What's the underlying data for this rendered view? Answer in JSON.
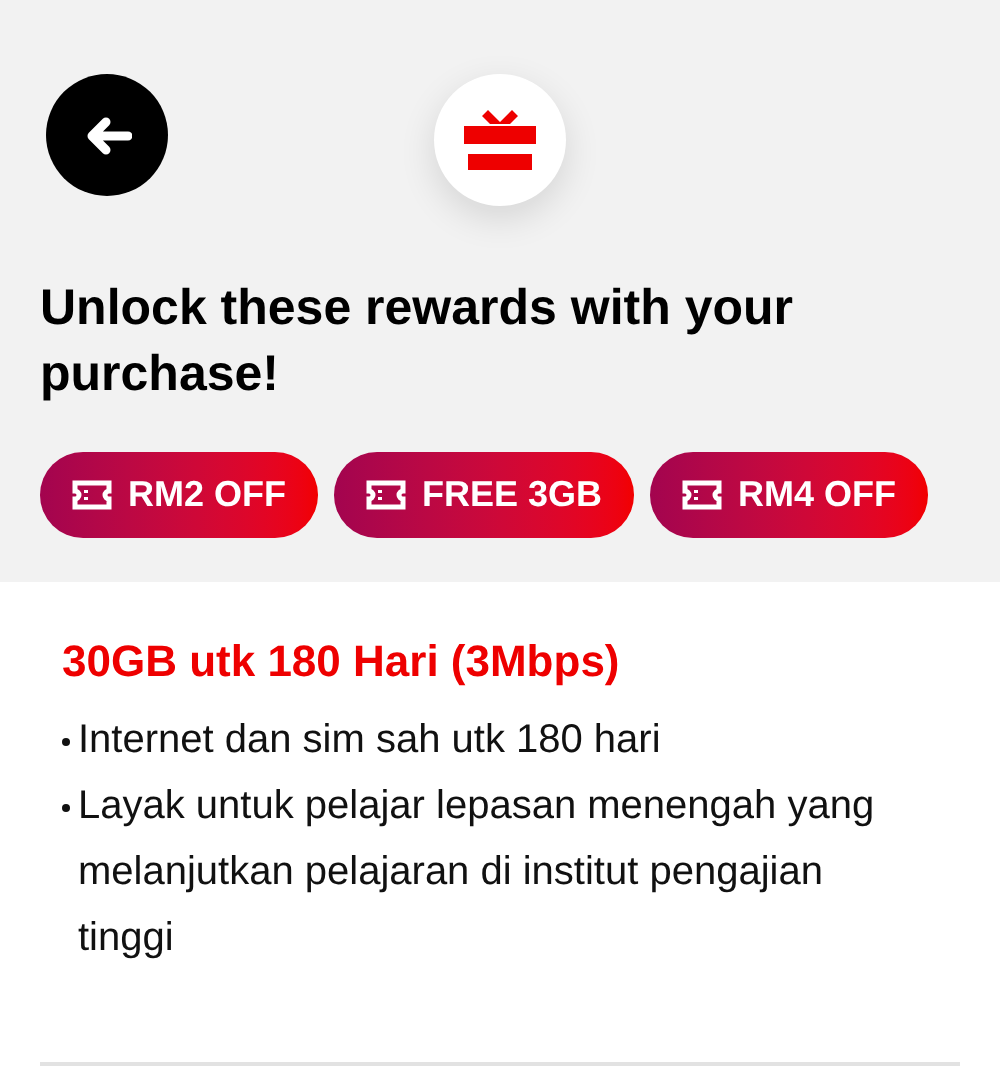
{
  "header": {
    "heading": "Unlock these rewards with your purchase!",
    "rewards": [
      {
        "label": "RM2 OFF"
      },
      {
        "label": "FREE 3GB"
      },
      {
        "label": "RM4 OFF"
      }
    ]
  },
  "plan": {
    "title": "30GB utk 180 Hari (3Mbps)",
    "features": [
      "Internet dan sim sah utk 180 hari",
      "Layak untuk pelajar lepasan menengah yang melanjutkan pelajaran di institut pengajian tinggi"
    ]
  }
}
